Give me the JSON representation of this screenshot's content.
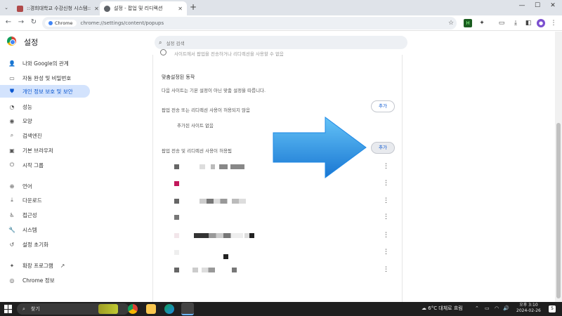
{
  "browser": {
    "tabs": [
      {
        "title": "::경희대학교 수강신청 시스템::",
        "favicon_color": "#b04a4a"
      },
      {
        "title": "설정 - 팝업 및 리디렉션",
        "favicon_color": "#5f6368"
      }
    ],
    "new_tab": "+",
    "window_controls": {
      "minimize": "—",
      "maximize": "☐",
      "close": "✕"
    },
    "tab_close": "✕",
    "chip_label": "Chrome",
    "url": "chrome://settings/content/popups"
  },
  "settings": {
    "title": "설정",
    "search_placeholder": "설정 검색",
    "sidebar": [
      {
        "label": "나와 Google의 관계",
        "icon": "person-icon",
        "glyph": "👤"
      },
      {
        "label": "자동 완성 및 비밀번호",
        "icon": "autofill-icon",
        "glyph": "▭"
      },
      {
        "label": "개인 정보 보호 및 보안",
        "icon": "shield-icon",
        "glyph": "⛊"
      },
      {
        "label": "성능",
        "icon": "performance-icon",
        "glyph": "◔"
      },
      {
        "label": "모양",
        "icon": "palette-icon",
        "glyph": "◉"
      },
      {
        "label": "검색엔진",
        "icon": "search-icon",
        "glyph": "⌕"
      },
      {
        "label": "기본 브라우저",
        "icon": "browser-icon",
        "glyph": "▣"
      },
      {
        "label": "시작 그룹",
        "icon": "power-icon",
        "glyph": "⏻"
      },
      {
        "label": "언어",
        "icon": "globe-icon",
        "glyph": "⊕"
      },
      {
        "label": "다운로드",
        "icon": "download-icon",
        "glyph": "⤓"
      },
      {
        "label": "접근성",
        "icon": "accessibility-icon",
        "glyph": "♿"
      },
      {
        "label": "시스템",
        "icon": "wrench-icon",
        "glyph": "🔧"
      },
      {
        "label": "설정 초기화",
        "icon": "reset-icon",
        "glyph": "↺"
      },
      {
        "label": "확장 프로그램",
        "icon": "extension-icon",
        "glyph": "✦"
      },
      {
        "label": "Chrome 정보",
        "icon": "chrome-icon",
        "glyph": "◎"
      }
    ],
    "top_cut_text": "사이트에서 팝업을 전송하거나 리디렉션을 사용할 수 없음",
    "custom_heading": "맞춤설정된 동작",
    "custom_desc": "다음 사이트는 기본 설정이 아닌 맞춤 설정을 따릅니다.",
    "blocked_heading": "팝업 전송 또는 리디렉션 사용이 허용되지 않음",
    "blocked_empty": "추가된 사이트 없음",
    "allowed_heading": "팝업 전송 및 리디렉션 사용이 허용됨",
    "add_label": "추가",
    "kebab": "⋮"
  },
  "taskbar": {
    "search_label": "찾기",
    "weather": "6°C 대체로 흐림",
    "time": "오후 3:10",
    "date": "2024-02-26",
    "notification_count": "5"
  },
  "colors": {
    "accent": "#0b57d0",
    "active_nav_bg": "#d3e3fd",
    "arrow": "#2196f3"
  }
}
